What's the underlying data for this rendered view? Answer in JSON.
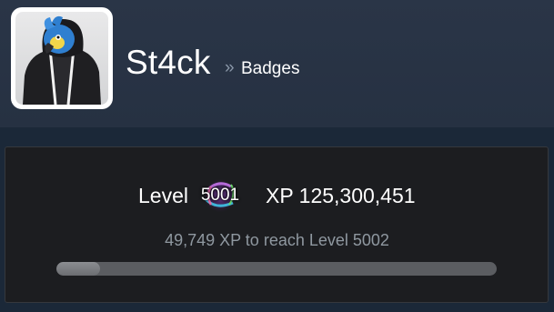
{
  "profile": {
    "name": "St4ck",
    "breadcrumb_separator": "»",
    "page": "Badges",
    "avatar_icon": "blue-parrot-hoodie-avatar"
  },
  "level": {
    "label": "Level",
    "value": "5001",
    "badge_icon": "level-badge-swirl-icon",
    "xp_text": "XP 125,300,451",
    "next_text": "49,749 XP to reach Level 5002",
    "progress_fraction": 0.1
  },
  "colors": {
    "page_bg": "#1b2838",
    "header_bg": "#2a3547",
    "panel_bg": "#1c1d20",
    "progress_track": "#5b5d61",
    "progress_fill": "#8c8e92",
    "muted_text": "#8f98a0"
  }
}
